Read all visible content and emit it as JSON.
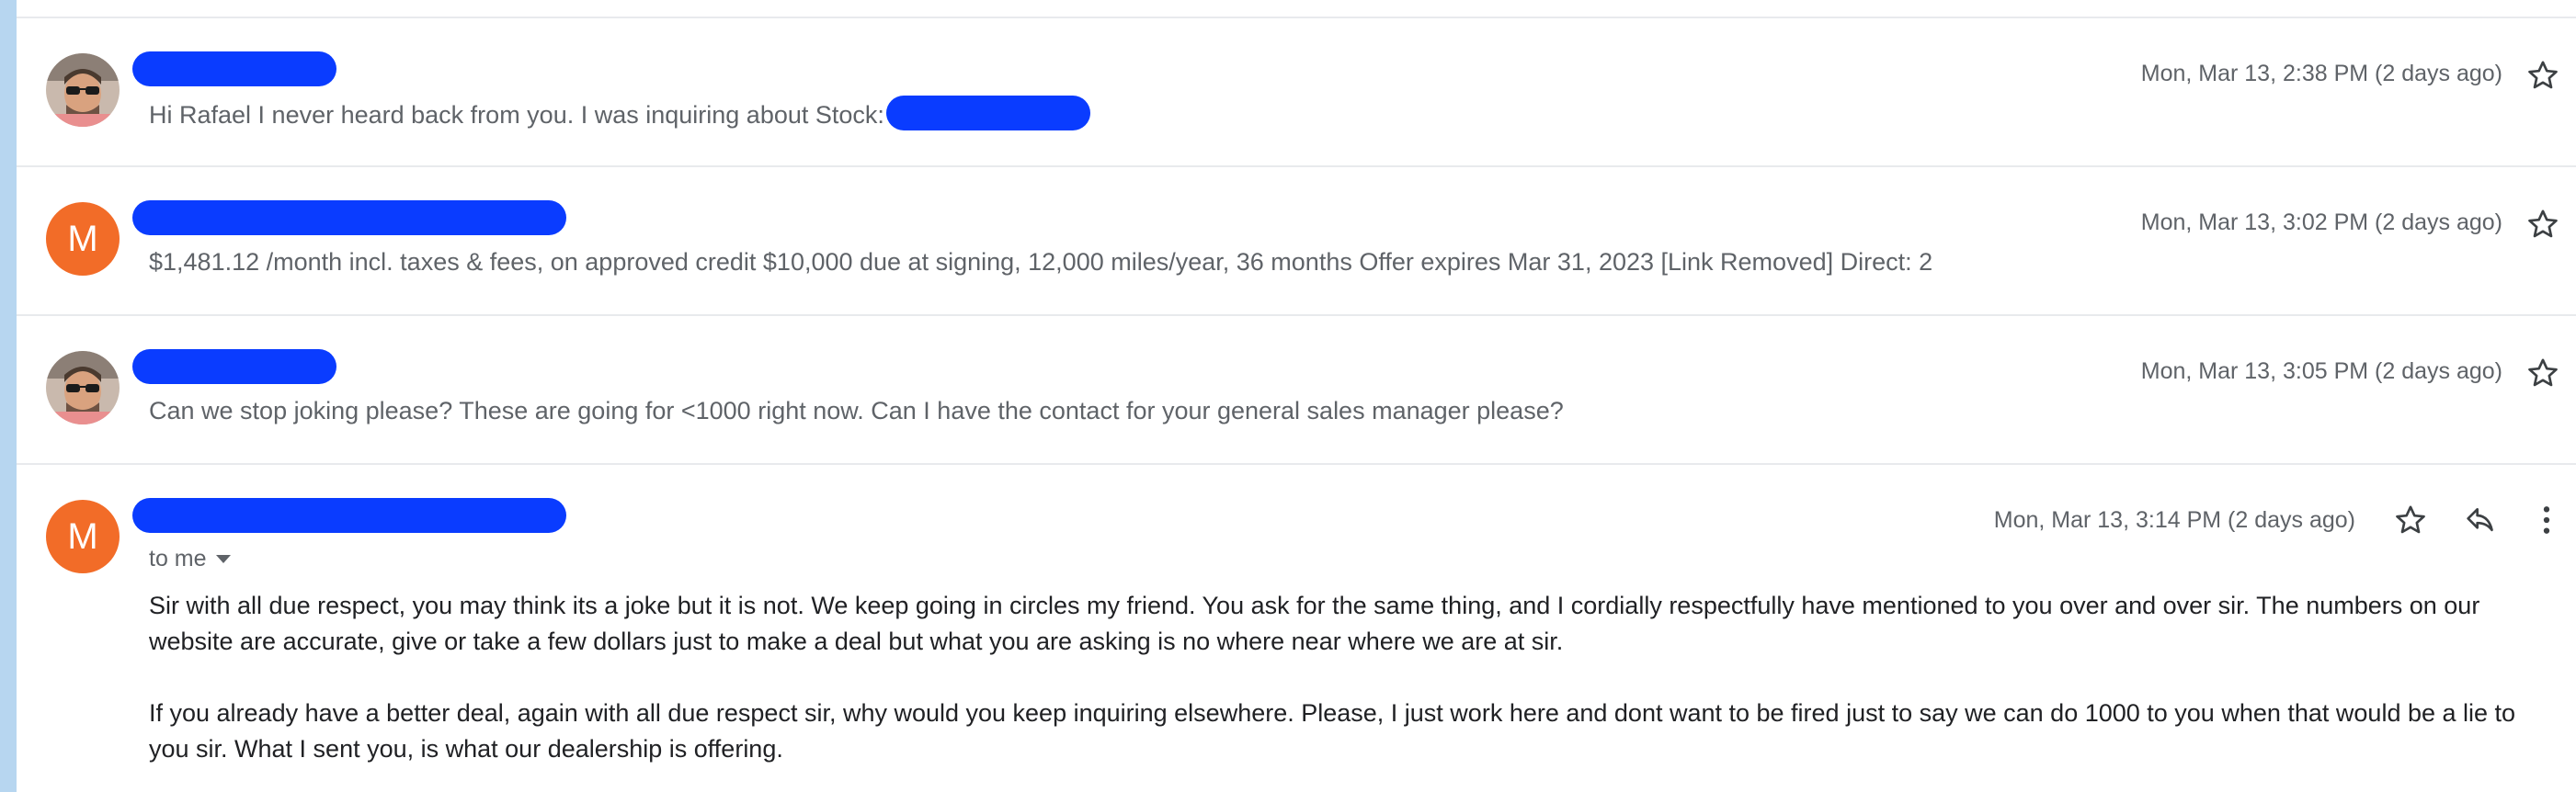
{
  "messages": [
    {
      "avatar": "photo",
      "sender_redacted": true,
      "snippet": "Hi Rafael I never heard back from you. I was inquiring about Stock:",
      "date": "Mon, Mar 13, 2:38 PM (2 days ago)"
    },
    {
      "avatar": "M",
      "avatar_color": "#f26c28",
      "sender_redacted": true,
      "snippet": "$1,481.12 /month incl. taxes & fees, on approved credit $10,000 due at signing, 12,000 miles/year, 36 months Offer expires Mar 31, 2023 [Link Removed] Direct: 2",
      "date": "Mon, Mar 13, 3:02 PM (2 days ago)"
    },
    {
      "avatar": "photo",
      "sender_redacted": true,
      "snippet": "Can we stop joking please? These are going for <1000 right now. Can I have the contact for your general sales manager please?",
      "date": "Mon, Mar 13, 3:05 PM (2 days ago)"
    }
  ],
  "open_message": {
    "avatar": "M",
    "avatar_color": "#f26c28",
    "sender_redacted": true,
    "to_label": "to me",
    "date": "Mon, Mar 13, 3:14 PM (2 days ago)",
    "paragraphs": [
      "Sir with all due respect, you may think its a joke but it is not. We keep going in circles my friend. You ask for the same thing, and I cordially respectfully have mentioned to you over and over sir. The numbers on our website are accurate, give or take a few dollars just to make a deal but what you are asking is no where near where we are at sir.",
      "If you already have a better deal, again with all due respect sir, why would you keep inquiring elsewhere. Please, I just work here and dont want to be fired just to say we can do 1000 to you when that would be a lie to you sir. What I sent you, is what our dealership is offering."
    ]
  },
  "icons": {
    "star": "star-icon",
    "reply": "reply-icon",
    "more": "more-vert-icon",
    "caret": "caret-down-icon"
  },
  "colors": {
    "redaction": "#0a3cff",
    "left_bar": "#b7d6f0",
    "avatar_orange": "#f26c28"
  }
}
